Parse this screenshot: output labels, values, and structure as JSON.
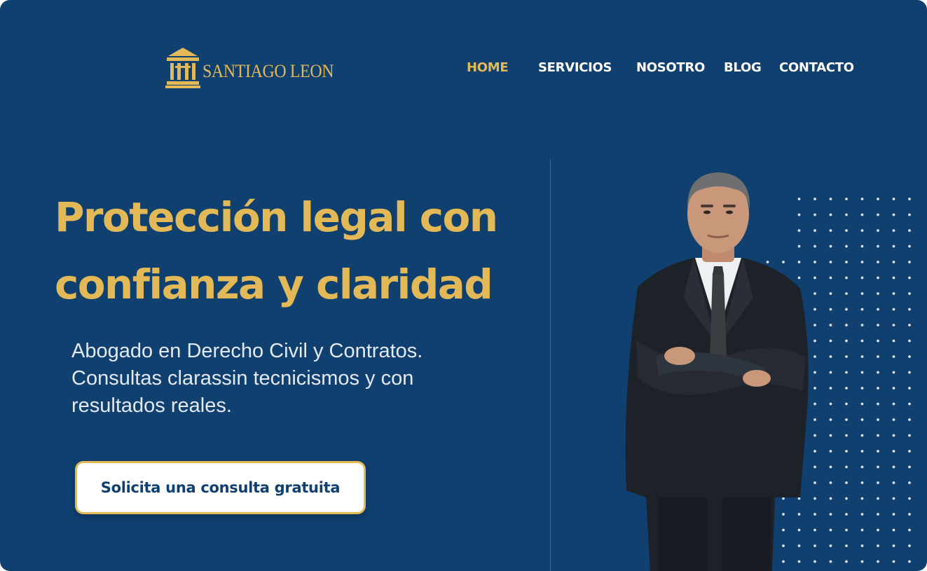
{
  "brand": {
    "name": "SANTIAGO LEON",
    "logo_icon": "courthouse-icon",
    "accent_color": "#e3b957",
    "background_color": "#0f4070"
  },
  "nav": {
    "items": [
      {
        "label": "HOME",
        "active": true
      },
      {
        "label": "SERVICIOS",
        "active": false
      },
      {
        "label": "NOSOTRO",
        "active": false
      },
      {
        "label": "BLOG",
        "active": false
      },
      {
        "label": "CONTACTO",
        "active": false
      }
    ]
  },
  "hero": {
    "headline_line1": "Protección legal con",
    "headline_line2": "confianza y claridad",
    "subtitle": "Abogado en Derecho Civil y Contratos.\n Consultas clarassin tecnicismos y con\nresultados reales.",
    "cta_label": "Solicita una consulta gratuita",
    "image": "lawyer-portrait"
  }
}
